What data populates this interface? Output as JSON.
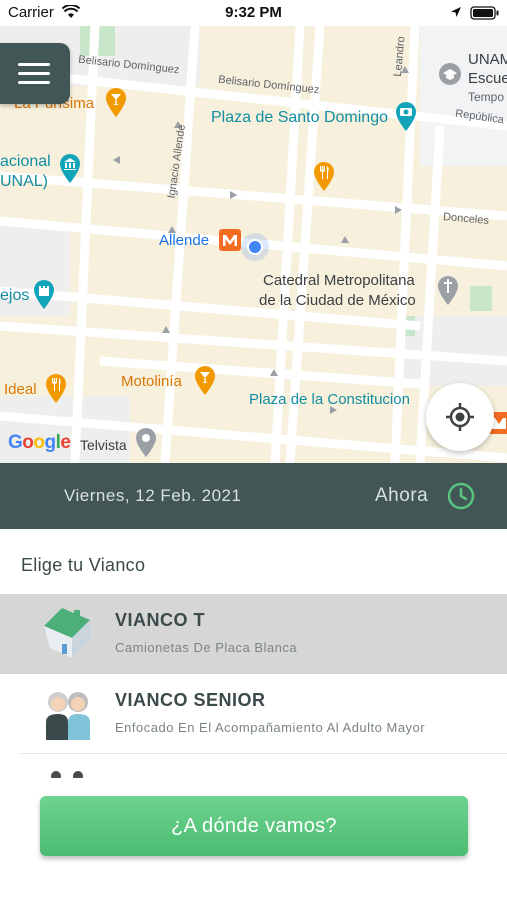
{
  "status_bar": {
    "carrier": "Carrier",
    "time": "9:32 PM"
  },
  "map": {
    "streets": {
      "belisario_1": "Belisario Domínguez",
      "belisario_2": "Belisario Domínguez",
      "leandro": "Leandro",
      "ignacio": "Ignacio Allende",
      "donceles": "Donceles",
      "republica": "República"
    },
    "places": {
      "la_purisima": "La Purísima",
      "plaza_santo_domingo": "Plaza de Santo Domingo",
      "unam_1": "UNAM",
      "unam_2": "Escue",
      "unam_3": "Tempo",
      "nacional_1": "acional",
      "nacional_2": "UNAL)",
      "allende": "Allende",
      "catedral_1": "Catedral Metropolitana",
      "catedral_2": "de la Ciudad de México",
      "ejos": "ejos",
      "ideal": "Ideal",
      "motolinia": "Motolinía",
      "plaza_constitucion": "Plaza de la Constitucion",
      "telvista": "Telvista"
    },
    "google_logo": [
      "G",
      "o",
      "o",
      "g",
      "l",
      "e"
    ],
    "google_colors": [
      "#4285F4",
      "#EA4335",
      "#FBBC05",
      "#4285F4",
      "#34A853",
      "#EA4335"
    ]
  },
  "date_bar": {
    "date": "Viernes, 12 Feb. 2021",
    "time": "Ahora"
  },
  "section": {
    "title": "Elige tu Vianco"
  },
  "options": [
    {
      "title": "VIANCO T",
      "subtitle": "Camionetas De Placa Blanca",
      "icon": "house-icon",
      "selected": true
    },
    {
      "title": "VIANCO SENIOR",
      "subtitle": "Enfocado En El Acompañamiento Al Adulto Mayor",
      "icon": "seniors-icon",
      "selected": false
    }
  ],
  "cta": {
    "label": "¿A dónde vamos?"
  },
  "colors": {
    "dark_teal": "#435656",
    "green": "#4bbb71",
    "map_bg": "#f6f0dc"
  }
}
